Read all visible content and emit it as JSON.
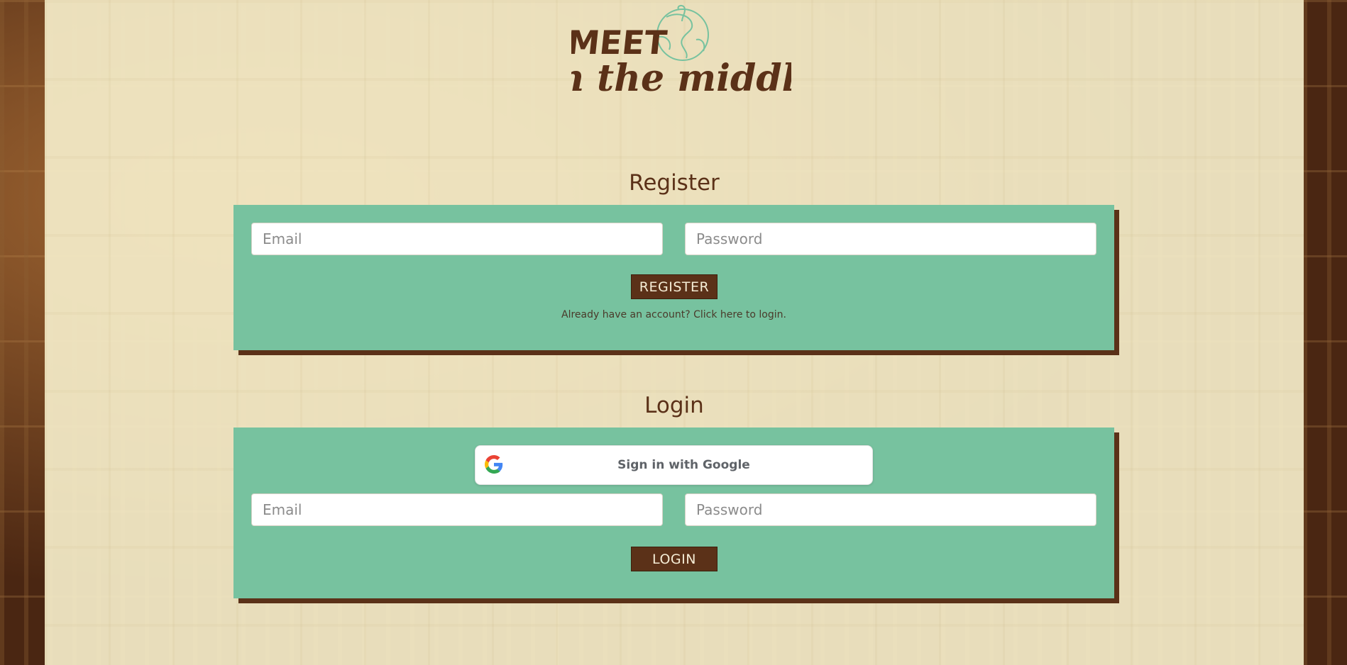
{
  "logo": {
    "word_top": "MEET",
    "word_bottom": "in the middle"
  },
  "register": {
    "title": "Register",
    "email_placeholder": "Email",
    "password_placeholder": "Password",
    "button_label": "REGISTER",
    "login_link": "Already have an account? Click here to login."
  },
  "login": {
    "title": "Login",
    "google_label": "Sign in with Google",
    "email_placeholder": "Email",
    "password_placeholder": "Password",
    "button_label": "LOGIN"
  },
  "colors": {
    "card": "#77c29f",
    "brown": "#5b3118",
    "cream": "#f4ecc8"
  },
  "icons": [
    "globe-icon",
    "google-g-icon"
  ]
}
